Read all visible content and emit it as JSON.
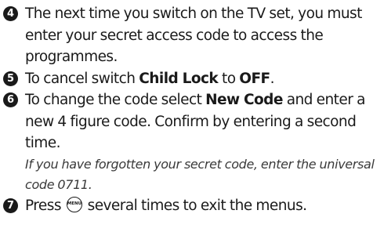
{
  "steps": [
    {
      "number": "4",
      "text": "The next time you switch on the TV set, you must enter your secret access code to access the programmes."
    },
    {
      "number": "5",
      "text_before": "To cancel switch ",
      "bold1": "Child Lock",
      "text_middle": " to ",
      "bold2": "OFF",
      "text_after": "."
    },
    {
      "number": "6",
      "text_before": "To change the code select ",
      "bold1": "New Code",
      "text_after": " and enter a new 4 figure code. Confirm by entering a second time.",
      "note": "If you have forgotten your secret code, enter the universal code 0711."
    },
    {
      "number": "7",
      "text_before": "Press ",
      "key_label": "MENU",
      "key_icon": "menu-key-icon",
      "text_after": " several times to exit the menus."
    }
  ]
}
